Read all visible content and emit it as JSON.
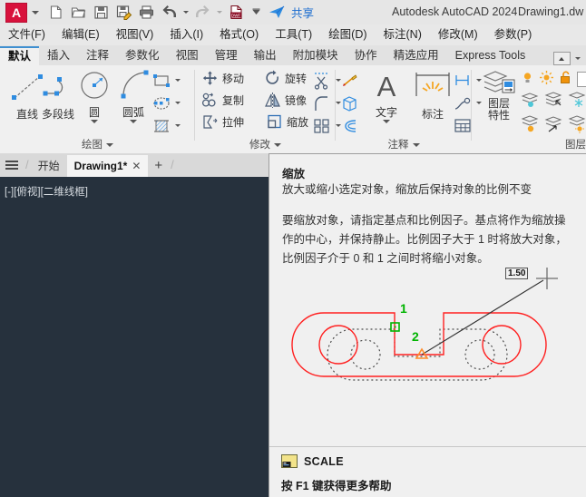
{
  "quick_access": {
    "app_logo": "A",
    "items": [
      {
        "name": "new-file-icon",
        "label": "新建"
      },
      {
        "name": "open-file-icon",
        "label": "打开"
      },
      {
        "name": "save-icon",
        "label": "保存"
      },
      {
        "name": "save-as-icon",
        "label": "另存为"
      },
      {
        "name": "print-icon",
        "label": "打印"
      },
      {
        "name": "undo-icon",
        "label": "放弃"
      },
      {
        "name": "redo-icon",
        "label": "重做"
      },
      {
        "name": "plot-dwf-icon",
        "label": "DWF"
      }
    ],
    "dwf_label": "DWF",
    "share_label": "共享"
  },
  "titlebar": {
    "product": "Autodesk AutoCAD 2024",
    "filename": "Drawing1.dw"
  },
  "menubar": {
    "items": [
      {
        "label": "文件(F)",
        "name": "menu-file"
      },
      {
        "label": "编辑(E)",
        "name": "menu-edit"
      },
      {
        "label": "视图(V)",
        "name": "menu-view"
      },
      {
        "label": "插入(I)",
        "name": "menu-insert"
      },
      {
        "label": "格式(O)",
        "name": "menu-format"
      },
      {
        "label": "工具(T)",
        "name": "menu-tools"
      },
      {
        "label": "绘图(D)",
        "name": "menu-draw"
      },
      {
        "label": "标注(N)",
        "name": "menu-dimension"
      },
      {
        "label": "修改(M)",
        "name": "menu-modify"
      },
      {
        "label": "参数(P)",
        "name": "menu-parametric"
      }
    ]
  },
  "ribbon_tabs": {
    "items": [
      {
        "label": "默认",
        "name": "ribbon-tab-home",
        "active": true
      },
      {
        "label": "插入",
        "name": "ribbon-tab-insert",
        "active": false
      },
      {
        "label": "注释",
        "name": "ribbon-tab-annotate",
        "active": false
      },
      {
        "label": "参数化",
        "name": "ribbon-tab-parametric",
        "active": false
      },
      {
        "label": "视图",
        "name": "ribbon-tab-view",
        "active": false
      },
      {
        "label": "管理",
        "name": "ribbon-tab-manage",
        "active": false
      },
      {
        "label": "输出",
        "name": "ribbon-tab-output",
        "active": false
      },
      {
        "label": "附加模块",
        "name": "ribbon-tab-addins",
        "active": false
      },
      {
        "label": "协作",
        "name": "ribbon-tab-collaborate",
        "active": false
      },
      {
        "label": "精选应用",
        "name": "ribbon-tab-featured-apps",
        "active": false
      },
      {
        "label": "Express Tools",
        "name": "ribbon-tab-express-tools",
        "active": false
      }
    ]
  },
  "ribbon": {
    "draw_panel": {
      "title": "绘图",
      "big_buttons": [
        {
          "label": "直线",
          "name": "line-button"
        },
        {
          "label": "多段线",
          "name": "polyline-button"
        },
        {
          "label": "圆",
          "name": "circle-button",
          "has_dropdown": true
        },
        {
          "label": "圆弧",
          "name": "arc-button",
          "has_dropdown": true
        }
      ],
      "small_icons": [
        {
          "name": "rectangle-icon"
        },
        {
          "name": "ellipse-icon"
        },
        {
          "name": "hatch-icon"
        }
      ]
    },
    "modify_panel": {
      "title": "修改",
      "buttons": [
        {
          "label": "移动",
          "name": "move-button"
        },
        {
          "label": "旋转",
          "name": "rotate-button"
        },
        {
          "label": "复制",
          "name": "copy-button"
        },
        {
          "label": "镜像",
          "name": "mirror-button"
        },
        {
          "label": "拉伸",
          "name": "stretch-button"
        },
        {
          "label": "缩放",
          "name": "scale-button",
          "highlighted": true
        }
      ],
      "side_icons": [
        {
          "name": "trim-icon"
        },
        {
          "name": "fillet-icon"
        },
        {
          "name": "array-icon"
        }
      ],
      "highlight_color": "#f2556a"
    },
    "annotation_panel": {
      "title": "注释",
      "big_buttons": [
        {
          "label": "文字",
          "name": "text-button",
          "has_dropdown": true
        },
        {
          "label": "标注",
          "name": "dimension-button"
        }
      ],
      "side_icons": [
        {
          "name": "linear-dimension-icon"
        },
        {
          "name": "leader-icon"
        },
        {
          "name": "table-icon"
        }
      ],
      "left_icons": [
        {
          "name": "multileader-icon"
        },
        {
          "name": "block-icon"
        },
        {
          "name": "revision-cloud-icon"
        }
      ]
    },
    "layers_panel": {
      "title": "图层",
      "big_button": {
        "line1": "图层",
        "line2": "特性",
        "name": "layer-properties-button"
      },
      "state_icons": [
        {
          "name": "layer-on-icon"
        },
        {
          "name": "layer-thaw-icon"
        },
        {
          "name": "layer-unlock-icon"
        }
      ],
      "grid_icons": [
        {
          "name": "layer-isolate-icon"
        },
        {
          "name": "layer-match-icon"
        },
        {
          "name": "layer-freeze-icon"
        },
        {
          "name": "layer-off-icon"
        },
        {
          "name": "layer-previous-icon"
        },
        {
          "name": "layer-state-icon"
        }
      ]
    }
  },
  "file_tabs": {
    "menu_icon": "hamburger-icon",
    "items": [
      {
        "label": "开始",
        "name": "file-tab-start",
        "active": false,
        "closable": false
      },
      {
        "label": "Drawing1*",
        "name": "file-tab-drawing1",
        "active": true,
        "closable": true
      }
    ],
    "close_glyph": "✕",
    "new_tab_glyph": "+"
  },
  "canvas": {
    "viewport_label": "[-][俯视][二维线框]",
    "background_color": "#26313d"
  },
  "tooltip": {
    "title": "缩放",
    "subtitle": "放大或缩小选定对象，缩放后保持对象的比例不变",
    "body": "要缩放对象，请指定基点和比例因子。基点将作为缩放操作的中心，并保持静止。比例因子大于 1 时将放大对象，比例因子介于 0 和 1 之间时将缩小对象。",
    "command": "SCALE",
    "command_icon": "scale-command-icon",
    "help_hint": "按 F1 键获得更多帮助",
    "illustration": {
      "name": "scale-illustration",
      "dimension_label": "1.50",
      "marker_1": "1",
      "marker_2": "2",
      "shape_color": "#ff2020",
      "marker_color": "#00b400",
      "base_point_color": "#ff8c2a"
    }
  }
}
